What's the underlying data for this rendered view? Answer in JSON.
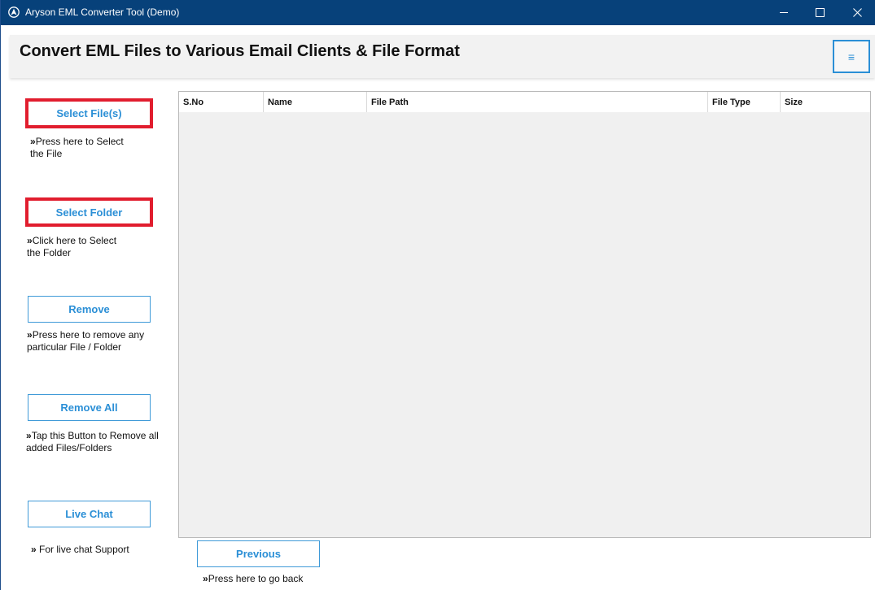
{
  "window": {
    "title": "Aryson EML Converter Tool (Demo)"
  },
  "header": {
    "title": "Convert EML Files to Various Email Clients & File Format",
    "menu_icon": "hamburger-icon",
    "menu_glyph": "≡"
  },
  "sidebar": {
    "select_files": {
      "label": "Select File(s)",
      "hint_arrow": "»",
      "hint_line1": "Press here to Select",
      "hint_line2": "the File"
    },
    "select_folder": {
      "label": "Select Folder",
      "hint_arrow": "»",
      "hint_line1": "Click here to Select",
      "hint_line2": "the Folder"
    },
    "remove": {
      "label": "Remove",
      "hint_arrow": "»",
      "hint_line1": "Press here to remove any",
      "hint_line2": "particular File / Folder"
    },
    "remove_all": {
      "label": "Remove All",
      "hint_arrow": "»",
      "hint_line1": "Tap this Button to Remove all",
      "hint_line2": "added Files/Folders"
    },
    "live_chat": {
      "label": "Live Chat",
      "hint_arrow": "»",
      "hint_line1": " For live chat Support"
    }
  },
  "file_table": {
    "columns": [
      "S.No",
      "Name",
      "File Path",
      "File Type",
      "Size"
    ],
    "rows": []
  },
  "footer": {
    "previous_label": "Previous",
    "previous_hint_arrow": "»",
    "previous_hint": "Press here to go back"
  },
  "colors": {
    "titlebar": "#07417a",
    "accent": "#2b8fd6",
    "highlight": "#e11d2e"
  }
}
